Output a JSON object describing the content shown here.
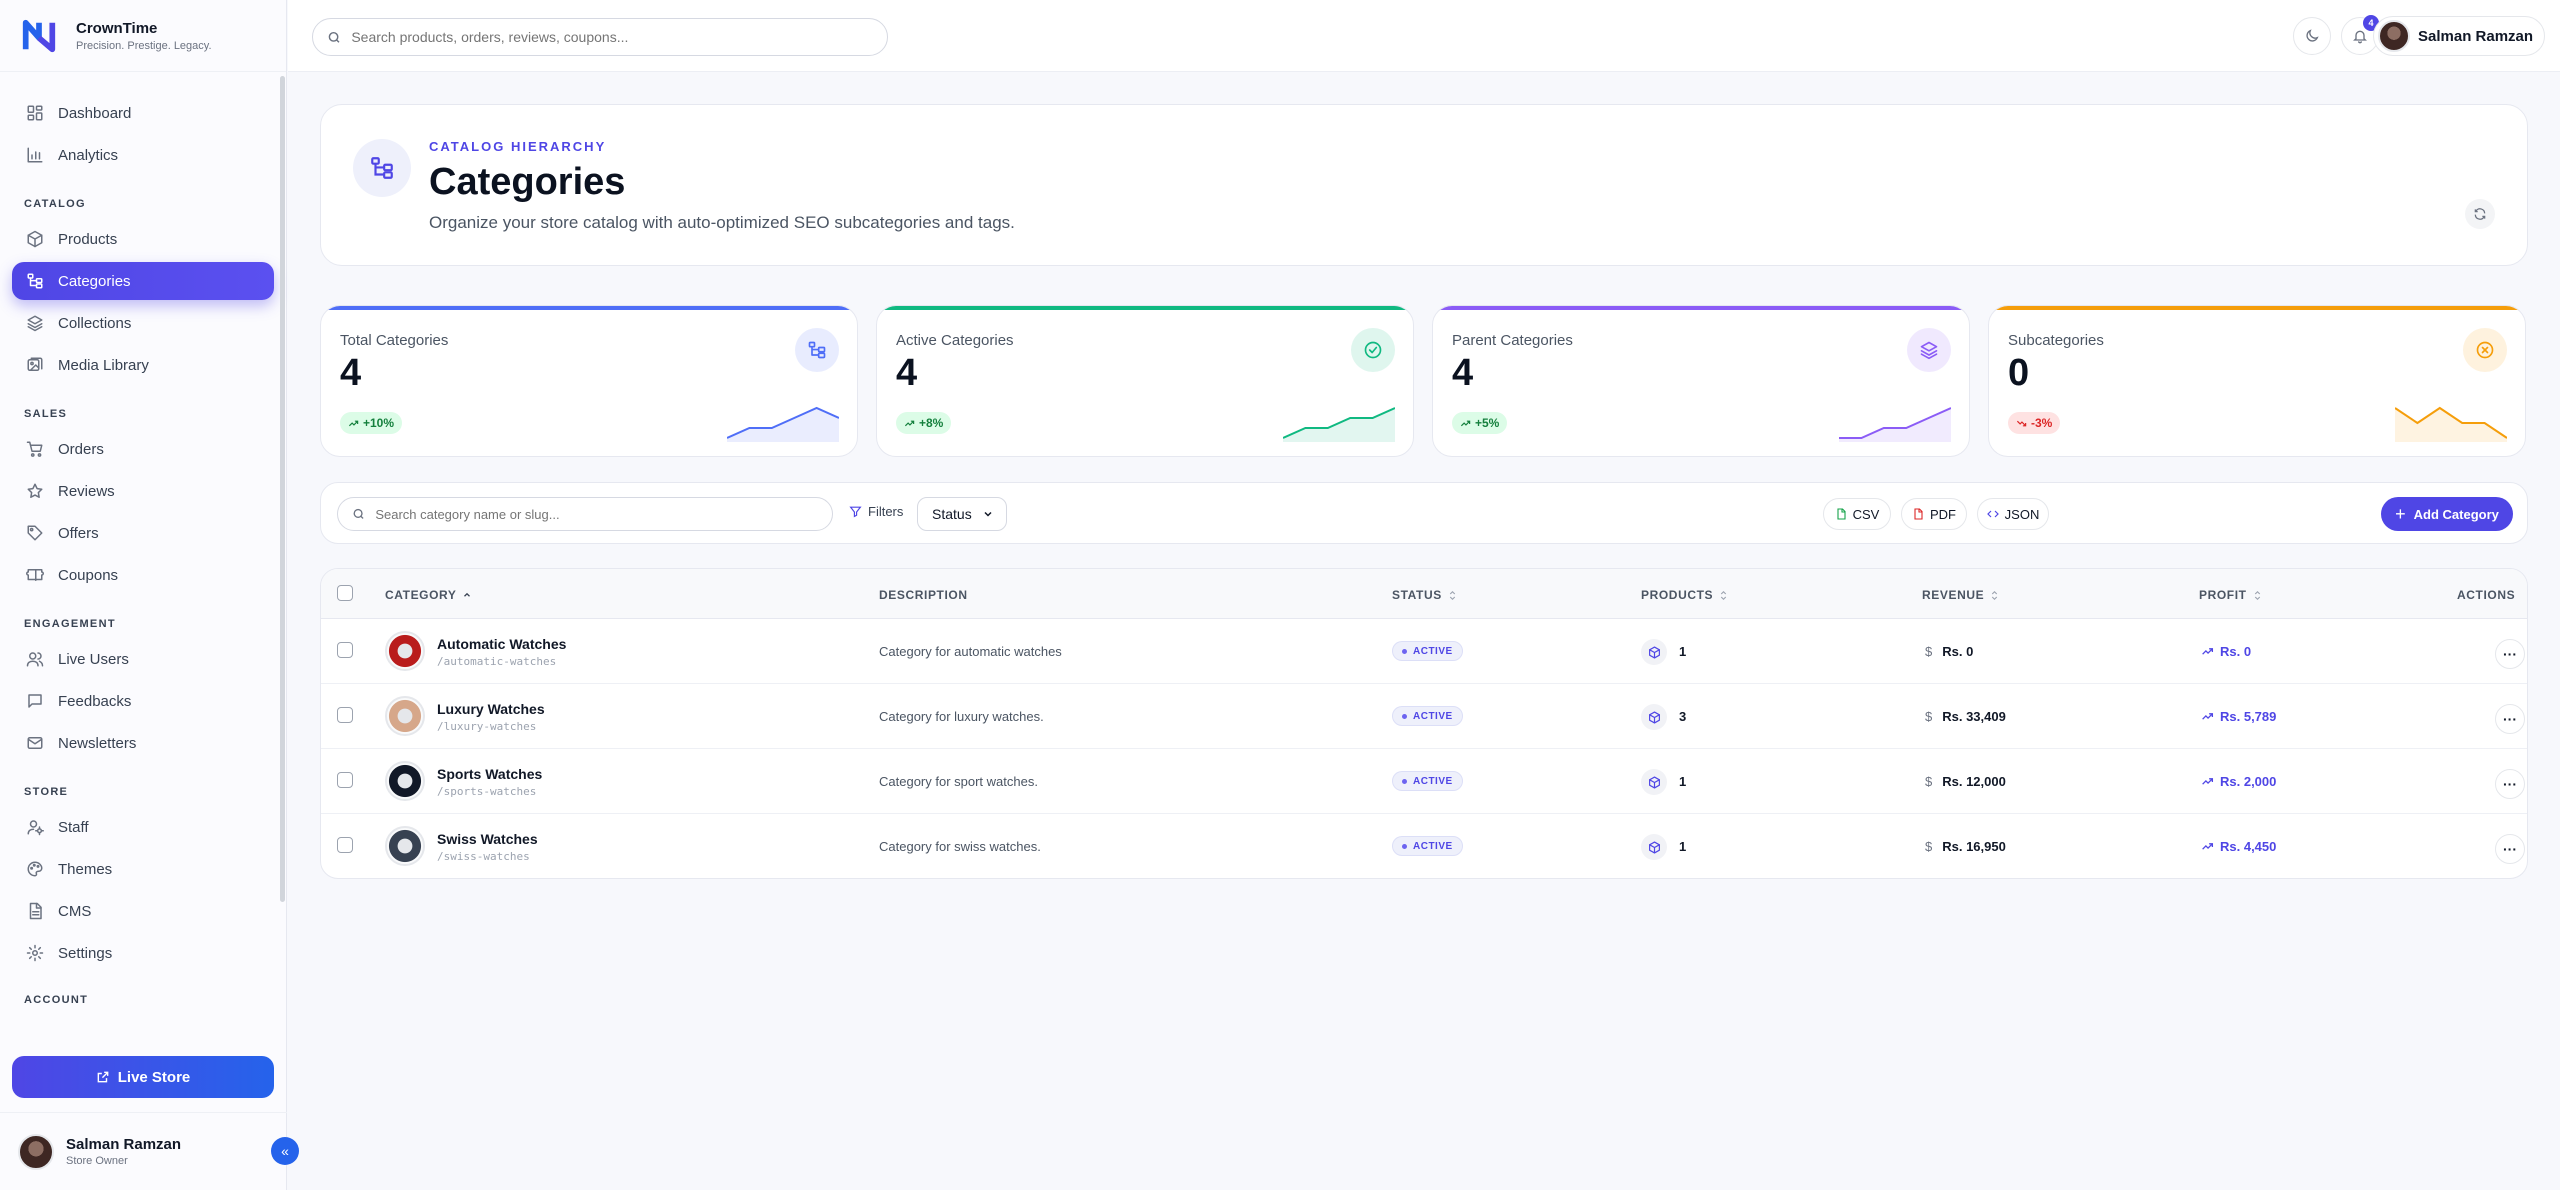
{
  "brand": {
    "name": "CrownTime",
    "tagline": "Precision. Prestige. Legacy."
  },
  "sidebar": {
    "top_items": [
      {
        "label": "Dashboard",
        "icon": "dashboard-icon"
      },
      {
        "label": "Analytics",
        "icon": "analytics-icon"
      }
    ],
    "sections": [
      {
        "title": "CATALOG",
        "items": [
          {
            "label": "Products",
            "icon": "box-icon"
          },
          {
            "label": "Categories",
            "icon": "hierarchy-icon",
            "active": true
          },
          {
            "label": "Collections",
            "icon": "layers-icon"
          },
          {
            "label": "Media Library",
            "icon": "image-icon"
          }
        ]
      },
      {
        "title": "SALES",
        "items": [
          {
            "label": "Orders",
            "icon": "cart-icon"
          },
          {
            "label": "Reviews",
            "icon": "star-icon"
          },
          {
            "label": "Offers",
            "icon": "tag-icon"
          },
          {
            "label": "Coupons",
            "icon": "ticket-icon"
          }
        ]
      },
      {
        "title": "ENGAGEMENT",
        "items": [
          {
            "label": "Live Users",
            "icon": "users-icon"
          },
          {
            "label": "Feedbacks",
            "icon": "message-icon"
          },
          {
            "label": "Newsletters",
            "icon": "mail-icon"
          }
        ]
      },
      {
        "title": "STORE",
        "items": [
          {
            "label": "Staff",
            "icon": "staff-icon"
          },
          {
            "label": "Themes",
            "icon": "palette-icon"
          },
          {
            "label": "CMS",
            "icon": "file-icon"
          },
          {
            "label": "Settings",
            "icon": "gear-icon"
          }
        ]
      }
    ],
    "cut_section": "ACCOUNT",
    "live_store_label": "Live Store",
    "user": {
      "name": "Salman Ramzan",
      "role": "Store Owner"
    }
  },
  "topbar": {
    "search_placeholder": "Search products, orders, reviews, coupons...",
    "notification_count": "4",
    "user_name": "Salman Ramzan"
  },
  "header": {
    "eyebrow": "CATALOG HIERARCHY",
    "title": "Categories",
    "subtitle": "Organize your store catalog with auto-optimized SEO subcategories and tags."
  },
  "stats": [
    {
      "label": "Total Categories",
      "value": "4",
      "trend": "+10%",
      "direction": "up",
      "color": "#4f6ef7",
      "icon": "hierarchy-icon",
      "spark": [
        2,
        3,
        3,
        4,
        5,
        4
      ]
    },
    {
      "label": "Active Categories",
      "value": "4",
      "trend": "+8%",
      "direction": "up",
      "color": "#10b981",
      "icon": "check-circle-icon",
      "spark": [
        1,
        2,
        2,
        3,
        3,
        4
      ]
    },
    {
      "label": "Parent Categories",
      "value": "4",
      "trend": "+5%",
      "direction": "up",
      "color": "#8b5cf6",
      "icon": "layers-icon",
      "spark": [
        1,
        1,
        2,
        2,
        3,
        4
      ]
    },
    {
      "label": "Subcategories",
      "value": "0",
      "trend": "-3%",
      "direction": "down",
      "color": "#f59e0b",
      "icon": "x-circle-icon",
      "spark": [
        4,
        3,
        4,
        3,
        3,
        2
      ]
    }
  ],
  "toolbar": {
    "search_placeholder": "Search category name or slug...",
    "filters_label": "Filters",
    "status_label": "Status",
    "csv_label": "CSV",
    "pdf_label": "PDF",
    "json_label": "JSON",
    "add_label": "Add Category"
  },
  "table": {
    "columns": [
      "CATEGORY",
      "DESCRIPTION",
      "STATUS",
      "PRODUCTS",
      "REVENUE",
      "PROFIT",
      "ACTIONS"
    ],
    "currency": "$",
    "rows": [
      {
        "name": "Automatic Watches",
        "slug": "/automatic-watches",
        "description": "Category for automatic watches",
        "status": "ACTIVE",
        "products": "1",
        "revenue": "Rs. 0",
        "profit": "Rs. 0",
        "thumb": "#b91c1c"
      },
      {
        "name": "Luxury Watches",
        "slug": "/luxury-watches",
        "description": "Category for luxury watches.",
        "status": "ACTIVE",
        "products": "3",
        "revenue": "Rs. 33,409",
        "profit": "Rs. 5,789",
        "thumb": "#d6a78a"
      },
      {
        "name": "Sports Watches",
        "slug": "/sports-watches",
        "description": "Category for sport watches.",
        "status": "ACTIVE",
        "products": "1",
        "revenue": "Rs. 12,000",
        "profit": "Rs. 2,000",
        "thumb": "#111827"
      },
      {
        "name": "Swiss Watches",
        "slug": "/swiss-watches",
        "description": "Category for swiss watches.",
        "status": "ACTIVE",
        "products": "1",
        "revenue": "Rs. 16,950",
        "profit": "Rs. 4,450",
        "thumb": "#374151"
      }
    ]
  }
}
